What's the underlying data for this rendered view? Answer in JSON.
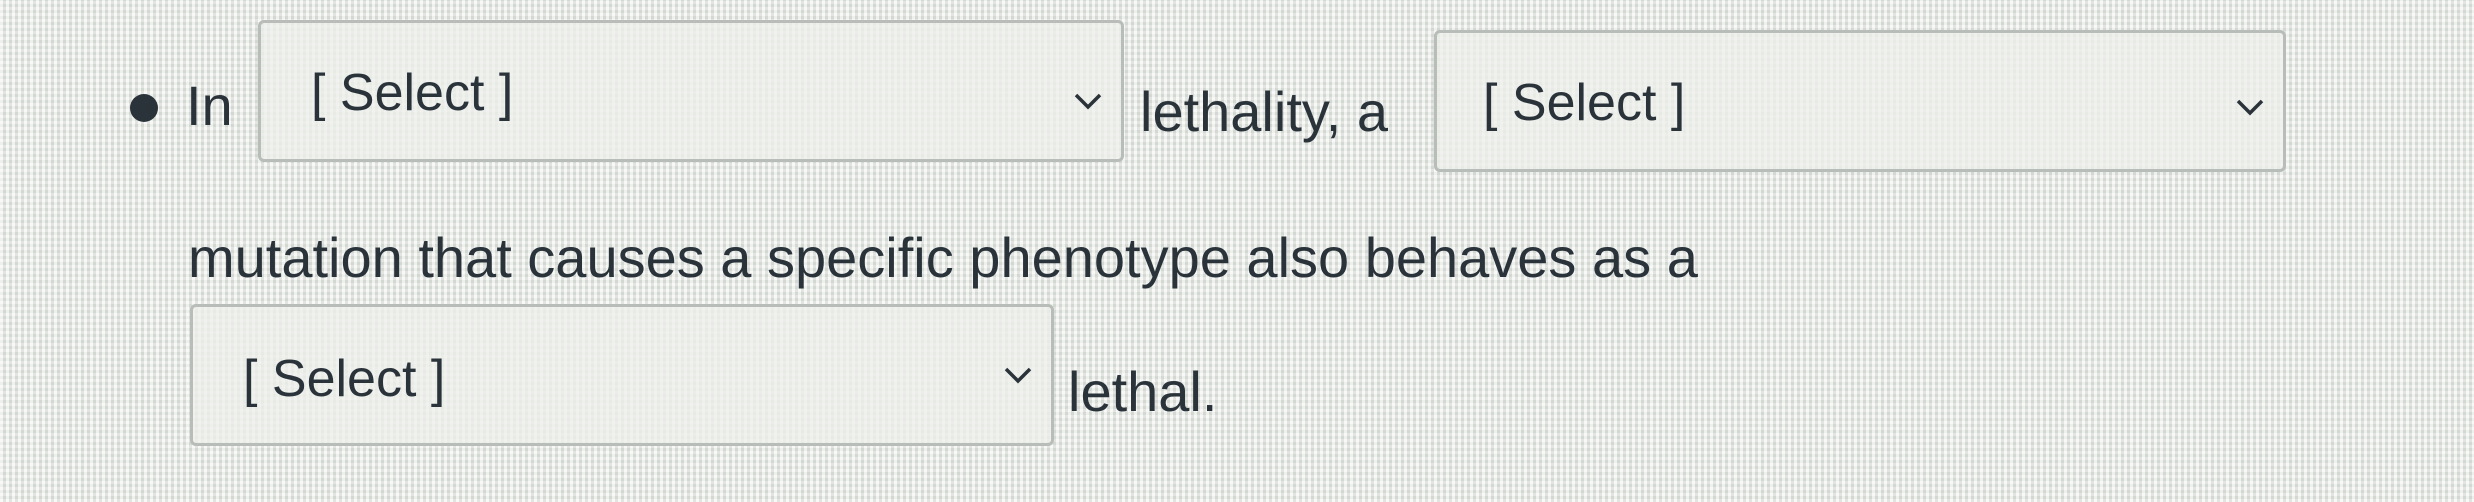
{
  "bullet_glyph": "•",
  "question": {
    "text_before_first": "In",
    "text_after_first": "lethality, a",
    "text_line_two": "mutation that causes a specific phenotype also behaves as a",
    "text_end": "lethal."
  },
  "selects": [
    {
      "value": "[ Select ]",
      "icon": "chevron-down-icon"
    },
    {
      "value": "[ Select ]",
      "icon": "chevron-down-icon"
    },
    {
      "value": "[ Select ]",
      "icon": "chevron-down-icon"
    }
  ],
  "colors": {
    "text": "#2b333a",
    "select_border": "#b8bdb9",
    "background": "#e6e8e4"
  }
}
